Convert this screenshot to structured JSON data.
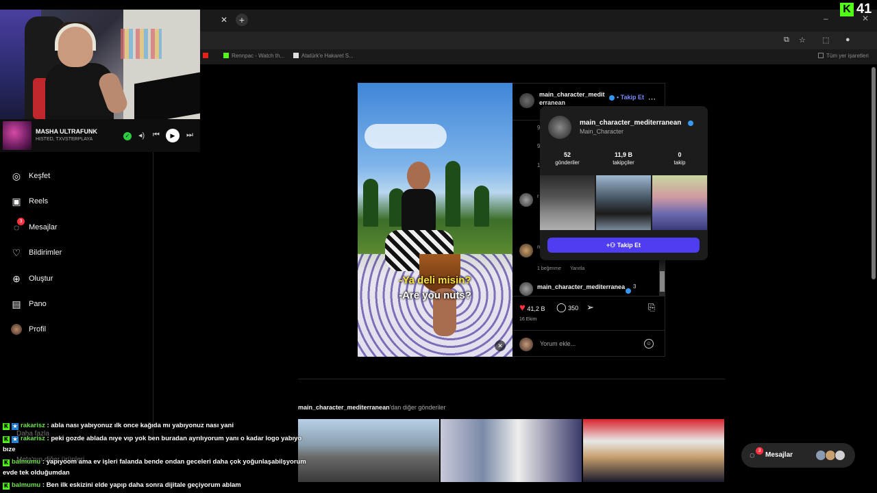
{
  "browser": {
    "counter_icon": "K",
    "counter_value": "41",
    "bookmarks": [
      {
        "label": "Rennpac - Watch th...",
        "color": "#53fc18"
      },
      {
        "label": "Atatürk'e Hakaret S...",
        "color": "#dddddd"
      }
    ],
    "bookmarks_all": "Tüm yer işaretleri"
  },
  "player": {
    "track": "MASHA ULTRAFUNK",
    "artist": "HISTED, TXVSTERPLAYA"
  },
  "nav": {
    "items": [
      {
        "label": "Keşfet",
        "icon": "compass-icon"
      },
      {
        "label": "Reels",
        "icon": "reels-icon"
      },
      {
        "label": "Mesajlar",
        "icon": "messenger-icon",
        "badge": "3"
      },
      {
        "label": "Bildirimler",
        "icon": "heart-icon"
      },
      {
        "label": "Oluştur",
        "icon": "plus-square-icon"
      },
      {
        "label": "Pano",
        "icon": "dashboard-icon"
      },
      {
        "label": "Profil",
        "icon": "avatar-icon"
      }
    ],
    "more": "Daha fazla",
    "also": "Meta'nın diğer ürünleri"
  },
  "post": {
    "username": "main_character_mediterranean",
    "follow": "Takip Et",
    "subtitle_tr": "-Ya deli misin?",
    "subtitle_en": "-Are you nuts?",
    "comment_likes": "1 beğenme",
    "comment_reply": "Yanıtla",
    "comment_user": "main_character_mediterranea",
    "comment_user_suffix": "3",
    "likes": "41,2 B",
    "comments": "350",
    "date": "16 Ekim",
    "comment_placeholder": "Yorum ekle..."
  },
  "hovercard": {
    "username": "main_character_mediterranean",
    "name": "Main_Character",
    "stats": [
      {
        "value": "52",
        "label": "gönderiler"
      },
      {
        "value": "11,9 B",
        "label": "takipçiler"
      },
      {
        "value": "0",
        "label": "takip"
      }
    ],
    "follow_button": "Takip Et"
  },
  "more_posts": {
    "owner": "main_character_mediterranean",
    "suffix": "'dan diğer gönderiler"
  },
  "chat": [
    {
      "user": "rakarisz",
      "text": "abla nası yabıyonuz ılk once kağıda mı yabıyonuz nası yani"
    },
    {
      "user": "rakarisz",
      "text": "peki gozde ablada nıye vıp yok ben buradan ayrılıyorum yanı o kadar logo yabıyo bıze"
    },
    {
      "user": "balmumu",
      "text": "yapıyoom ama ev işleri falanda bende ondan geceleri daha çok yoğunlaşabilşyorum evde tek olduğumdan"
    },
    {
      "user": "balmumu",
      "text": "Ben ilk eskizini elde yapıp daha sonra dijitale geçiyorum ablam"
    }
  ],
  "messages_pill": {
    "label": "Mesajlar",
    "badge": "3"
  }
}
